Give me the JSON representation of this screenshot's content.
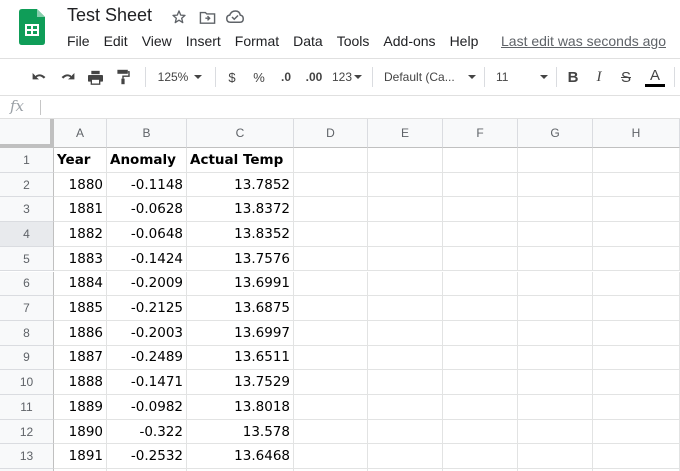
{
  "app": {
    "title": "Test Sheet",
    "last_edit": "Last edit was seconds ago",
    "menu": [
      "File",
      "Edit",
      "View",
      "Insert",
      "Format",
      "Data",
      "Tools",
      "Add-ons",
      "Help"
    ]
  },
  "toolbar": {
    "zoom": "125%",
    "currency": "$",
    "percent": "%",
    "decrease_decimal": ".0",
    "increase_decimal": ".00",
    "number_format": "123",
    "font": "Default (Ca...",
    "font_size": "11",
    "bold": "B",
    "italic": "I",
    "strike": "S",
    "text_color": "A"
  },
  "formula_bar": {
    "label": "fx",
    "value": ""
  },
  "sheet": {
    "columns": [
      "A",
      "B",
      "C",
      "D",
      "E",
      "F",
      "G",
      "H"
    ],
    "rows": [
      [
        "Year",
        "Anomaly",
        "Actual Temp"
      ],
      [
        "1880",
        "-0.1148",
        "13.7852"
      ],
      [
        "1881",
        "-0.0628",
        "13.8372"
      ],
      [
        "1882",
        "-0.0648",
        "13.8352"
      ],
      [
        "1883",
        "-0.1424",
        "13.7576"
      ],
      [
        "1884",
        "-0.2009",
        "13.6991"
      ],
      [
        "1885",
        "-0.2125",
        "13.6875"
      ],
      [
        "1886",
        "-0.2003",
        "13.6997"
      ],
      [
        "1887",
        "-0.2489",
        "13.6511"
      ],
      [
        "1888",
        "-0.1471",
        "13.7529"
      ],
      [
        "1889",
        "-0.0982",
        "13.8018"
      ],
      [
        "1890",
        "-0.322",
        "13.578"
      ],
      [
        "1891",
        "-0.2532",
        "13.6468"
      ]
    ],
    "selected_row": 4
  },
  "colors": {
    "logo_green": "#0f9d58",
    "header_bg": "#f8f9fa",
    "grid_line": "#e2e3e3"
  }
}
